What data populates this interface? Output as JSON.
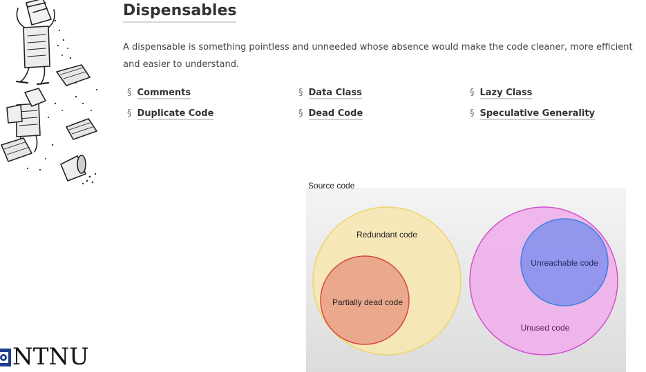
{
  "page": {
    "title": "Dispensables",
    "description": "A dispensable is something pointless and unneeded whose absence would make the code cleaner, more efficient and easier to understand."
  },
  "smells": [
    {
      "symbol": "§",
      "label": "Comments"
    },
    {
      "symbol": "§",
      "label": "Duplicate Code"
    },
    {
      "symbol": "§",
      "label": "Data Class"
    },
    {
      "symbol": "§",
      "label": "Dead Code"
    },
    {
      "symbol": "§",
      "label": "Lazy Class"
    },
    {
      "symbol": "§",
      "label": "Speculative Generality"
    }
  ],
  "diagram": {
    "caption": "Source code",
    "redundant": "Redundant code",
    "partially_dead": "Partially dead code",
    "unreachable": "Unreachable code",
    "unused": "Unused code",
    "colors": {
      "redundant_fill": "#f6e7b3",
      "redundant_stroke": "#ecd56a",
      "partial_fill": "#e9a48a",
      "partial_stroke": "#d9473b",
      "unused_fill": "#eeb0ea",
      "unused_stroke": "#d24fcc",
      "unreachable_fill": "#8d95ec",
      "unreachable_stroke": "#3a82e0"
    }
  },
  "branding": {
    "logo_text": "NTNU"
  }
}
